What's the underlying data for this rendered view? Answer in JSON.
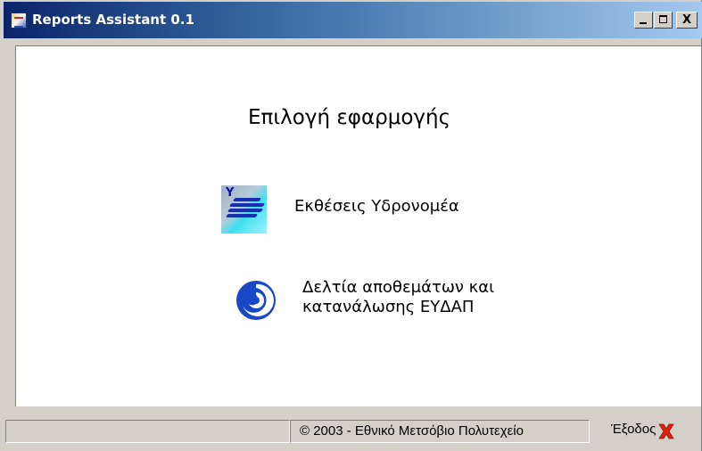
{
  "window": {
    "title": "Reports Assistant 0.1",
    "controls": {
      "minimize": "_",
      "maximize": "□",
      "close": "X"
    }
  },
  "main": {
    "heading": "Επιλογή εφαρμογής",
    "apps": [
      {
        "label": "Εκθέσεις Υδρονομέα",
        "icon": "hydronomeas-icon",
        "icon_letter": "Y"
      },
      {
        "label_line1": "Δελτία αποθεμάτων και",
        "label_line2": "κατανάλωσης ΕΥΔΑΠ",
        "icon": "eydap-swirl-icon"
      }
    ]
  },
  "statusbar": {
    "copyright": "© 2003 - Εθνικό Μετσόβιο Πολυτεχείο",
    "exit_label": "Έξοδος",
    "exit_icon": "red-x-icon"
  },
  "colors": {
    "titlebar_start": "#0a246a",
    "titlebar_end": "#a6caf0",
    "exit_x": "#e02010",
    "swirl": "#1848c8"
  }
}
